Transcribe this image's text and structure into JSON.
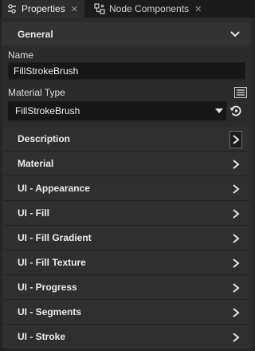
{
  "tabs": [
    {
      "label": "Properties",
      "icon": "properties-icon",
      "active": true
    },
    {
      "label": "Node Components",
      "icon": "node-components-icon",
      "active": false
    }
  ],
  "section": {
    "title": "General",
    "expanded": true
  },
  "name_field": {
    "label": "Name",
    "value": "FillStrokeBrush"
  },
  "material_type": {
    "label": "Material Type",
    "value": "FillStrokeBrush"
  },
  "properties": [
    {
      "label": "Description"
    },
    {
      "label": "Material"
    },
    {
      "label": "UI - Appearance"
    },
    {
      "label": "UI - Fill"
    },
    {
      "label": "UI - Fill Gradient"
    },
    {
      "label": "UI - Fill Texture"
    },
    {
      "label": "UI - Progress"
    },
    {
      "label": "UI - Segments"
    },
    {
      "label": "UI - Stroke"
    }
  ],
  "colors": {
    "background": "#252525",
    "panel": "#2b2b2b",
    "row": "#2f2f2f",
    "input": "#171717",
    "text": "#e6e6e6"
  }
}
